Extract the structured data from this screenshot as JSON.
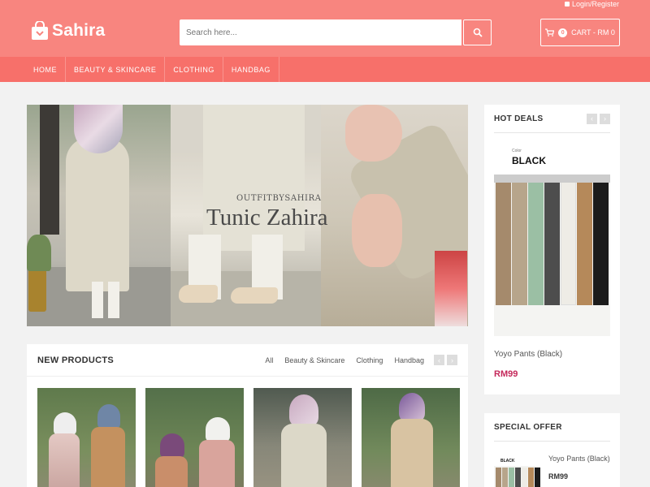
{
  "header": {
    "login_label": "Login/Register",
    "logo_text": "Sahira",
    "search": {
      "placeholder": "Search here..."
    },
    "cart": {
      "count": "0",
      "label": "CART - RM 0"
    },
    "colors": {
      "header_bg": "#f8857f",
      "nav_bg": "#f7706a",
      "price": "#c4285a"
    }
  },
  "nav": {
    "items": [
      {
        "label": "HOME"
      },
      {
        "label": "BEAUTY & SKINCARE"
      },
      {
        "label": "CLOTHING"
      },
      {
        "label": "HANDBAG"
      }
    ]
  },
  "hero": {
    "subtitle": "OUTFITBYSAHIRA",
    "title": "Tunic Zahira"
  },
  "new_products": {
    "title": "NEW PRODUCTS",
    "tabs": [
      {
        "label": "All"
      },
      {
        "label": "Beauty & Skincare"
      },
      {
        "label": "Clothing"
      },
      {
        "label": "Handbag"
      }
    ],
    "prev_icon": "chevron-left-icon",
    "next_icon": "chevron-right-icon"
  },
  "hot_deals": {
    "title": "HOT DEALS",
    "image_caption_small": "Color",
    "image_caption": "BLACK",
    "product_name": "Yoyo Pants (Black)",
    "price": "RM99"
  },
  "special_offer": {
    "title": "SPECIAL OFFER",
    "thumb_caption": "BLACK",
    "product_name": "Yoyo Pants (Black)",
    "price": "RM99"
  }
}
